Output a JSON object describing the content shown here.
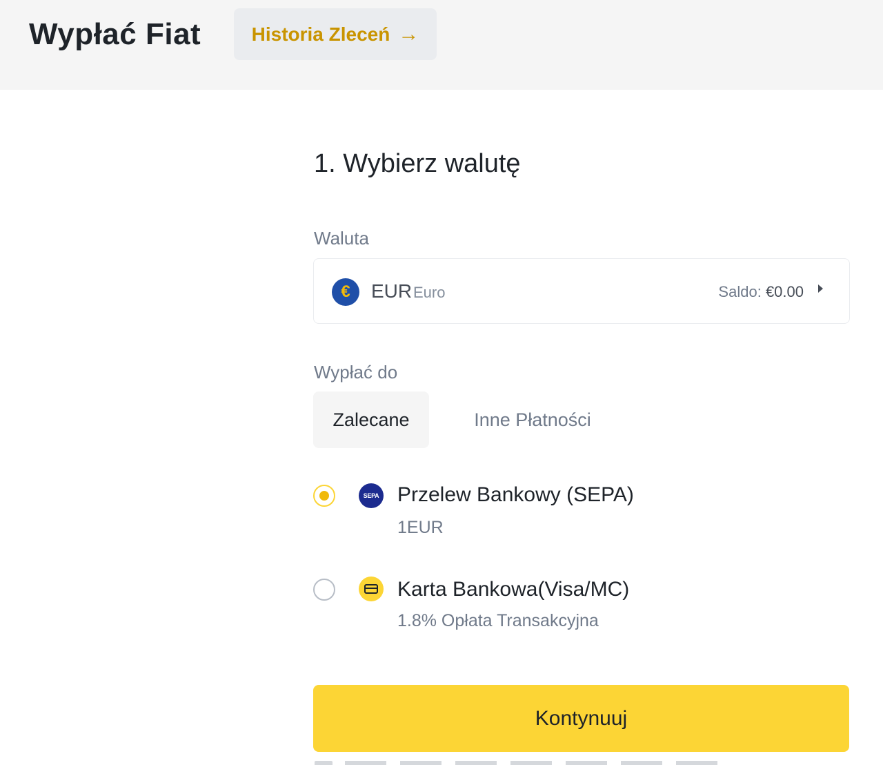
{
  "header": {
    "title": "Wypłać Fiat",
    "history_button": "Historia Zleceń",
    "history_arrow": "→"
  },
  "step": {
    "title": "1. Wybierz walutę"
  },
  "currency": {
    "label": "Waluta",
    "icon_glyph": "€",
    "code": "EUR",
    "name": "Euro",
    "balance_label": "Saldo:",
    "balance_value": "€0.00"
  },
  "withdraw": {
    "label": "Wypłać do",
    "tabs": [
      {
        "label": "Zalecane",
        "active": true
      },
      {
        "label": "Inne Płatności",
        "active": false
      }
    ],
    "methods": [
      {
        "name": "Przelew Bankowy (SEPA)",
        "fee": "1EUR",
        "selected": true,
        "icon_text": "SEPA",
        "icon": "sepa-icon"
      },
      {
        "name": "Karta Bankowa(Visa/MC)",
        "fee": "1.8% Opłata Transakcyjna",
        "selected": false,
        "icon": "card-icon"
      }
    ]
  },
  "actions": {
    "continue_label": "Kontynuuj"
  },
  "colors": {
    "accent": "#fcd535",
    "accent_text": "#c99400",
    "header_bg": "#f5f5f5"
  }
}
